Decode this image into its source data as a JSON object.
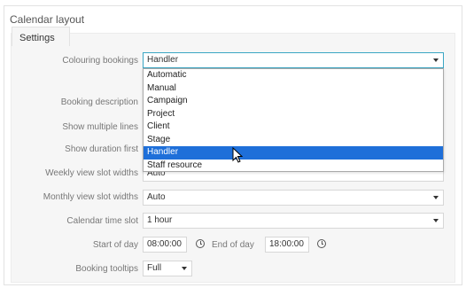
{
  "panel": {
    "title": "Calendar layout",
    "tab_label": "Settings"
  },
  "fields": {
    "colouring_bookings": {
      "label": "Colouring bookings",
      "value": "Handler"
    },
    "booking_description": {
      "label": "Booking description"
    },
    "show_multiple_lines": {
      "label": "Show multiple lines"
    },
    "show_duration_first": {
      "label": "Show duration first"
    },
    "weekly_view_slot_widths": {
      "label": "Weekly view slot widths",
      "value": "Auto"
    },
    "monthly_view_slot_widths": {
      "label": "Monthly view slot widths",
      "value": "Auto"
    },
    "calendar_time_slot": {
      "label": "Calendar time slot",
      "value": "1 hour"
    },
    "start_of_day": {
      "label": "Start of day",
      "value": "08:00:00"
    },
    "end_of_day": {
      "label": "End of day",
      "value": "18:00:00"
    },
    "booking_tooltips": {
      "label": "Booking tooltips",
      "value": "Full"
    }
  },
  "dropdown": {
    "options": [
      "Automatic",
      "Manual",
      "Campaign",
      "Project",
      "Client",
      "Stage",
      "Handler",
      "Staff resource"
    ],
    "selected": "Handler"
  },
  "colors": {
    "focus_border": "#3aa6c4",
    "selected_option": "#1e6fd9"
  }
}
